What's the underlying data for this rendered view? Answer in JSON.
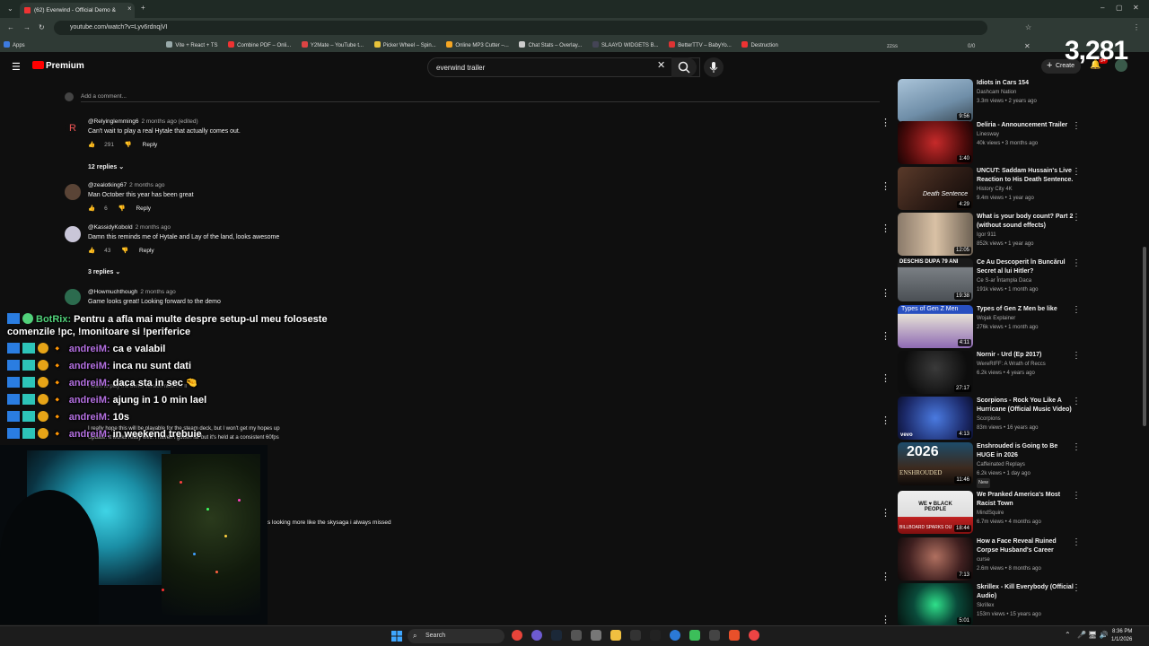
{
  "browser": {
    "tab_title": "(62) Everwind - Official Demo &",
    "url": "youtube.com/watch?v=Lyv6rdnqjVI",
    "bookmarks": [
      "Apps",
      "Vite + React + TS",
      "Combine PDF – Onli...",
      "Y2Mate – YouTube t...",
      "Picker Wheel – Spin...",
      "Online MP3 Cutter –...",
      "Chat Stats – Overlay...",
      "SLAAYD WIDGETS B...",
      "BetterTTV – BabyYo...",
      "Destruction"
    ],
    "find_text": "zzss",
    "find_count": "0/0"
  },
  "header": {
    "logo_text": "Premium",
    "search_value": "everwind trailer",
    "create_label": "Create",
    "notif_count": "9+",
    "viewer_count": "3,281"
  },
  "comments": {
    "add_placeholder": "Add a comment...",
    "items": [
      {
        "author": "@Relyinglemming6",
        "age": "2 months ago (edited)",
        "text": "Can't wait to play a real Hytale that actually comes out.",
        "likes": "291",
        "reply": "Reply",
        "replies": "12 replies"
      },
      {
        "author": "@zealotking67",
        "age": "2 months ago",
        "text": "Man October this year has been great",
        "likes": "6",
        "reply": "Reply",
        "replies": ""
      },
      {
        "author": "@KassidyKobold",
        "age": "2 months ago",
        "text": "Damn this reminds me of Hytale and Lay of the land, looks awesome",
        "likes": "43",
        "reply": "Reply",
        "replies": "3 replies"
      },
      {
        "author": "@Howmuchthough",
        "age": "2 months ago",
        "text": "Game looks great! Looking forward to the demo",
        "likes": "",
        "reply": "",
        "replies": ""
      }
    ],
    "partial_tail": "s looking more like the skysaga i always missed"
  },
  "chat": {
    "bot_name": "BotRix:",
    "bot_message_1": "Pentru a afla mai multe despre setup-ul meu foloseste",
    "bot_message_2": "comenzile !pc, !monitoare si !periferice",
    "lines": [
      {
        "name": "andreiM:",
        "text": "ca e valabil"
      },
      {
        "name": "andreiM:",
        "text": "inca nu sunt dati"
      },
      {
        "name": "andreiM:",
        "text": "daca sta in sec 🤏"
      },
      {
        "name": "andreiM:",
        "text": "ajung in 1 0 min lael"
      },
      {
        "name": "andreiM:",
        "text": "10s"
      },
      {
        "name": "andreiM:",
        "text": "in weekend trebuie"
      }
    ],
    "underlay": {
      "u1": "I want to play the demo version now!!!!!! ll",
      "u2": "I really hope this will be playable for the steam deck, but I won't get my hopes up",
      "u3": "Update: It works really well. I haven't gotten far but it's held at a consistent 60fps"
    }
  },
  "sidebar": {
    "videos": [
      {
        "title": "Idiots in Cars 154",
        "channel": "Dashcam Nation",
        "stats": "3.3m views • 2 years ago",
        "duration": "9:56",
        "new": ""
      },
      {
        "title": "Deliria - Announcement Trailer",
        "channel": "Linesway",
        "stats": "40k views • 3 months ago",
        "duration": "1:40",
        "new": ""
      },
      {
        "title": "UNCUT: Saddam Hussain's Live Reaction to His Death Sentence.",
        "channel": "History City 4K",
        "stats": "9.4m views • 1 year ago",
        "duration": "4:29",
        "new": ""
      },
      {
        "title": "What is your body count? Part 2 (without sound effects)",
        "channel": "Igor 911",
        "stats": "852k views • 1 year ago",
        "duration": "12:05",
        "new": ""
      },
      {
        "title": "Ce Au Descoperit în Buncărul Secret al lui Hitler?",
        "channel": "Ce S-ar Întampla Daca",
        "stats": "191k views • 1 month ago",
        "duration": "19:38",
        "new": ""
      },
      {
        "title": "Types of Gen Z Men be like",
        "channel": "Wojak Explainer",
        "stats": "276k views • 1 month ago",
        "duration": "4:11",
        "new": ""
      },
      {
        "title": "Nornir - Urd (Ep 2017)",
        "channel": "WereRIFF: A Wrath of Reccs",
        "stats": "6.2k views • 4 years ago",
        "duration": "27:17",
        "new": ""
      },
      {
        "title": "Scorpions - Rock You Like A Hurricane (Official Music Video)",
        "channel": "Scorpions",
        "stats": "83m views • 16 years ago",
        "duration": "4:13",
        "new": ""
      },
      {
        "title": "Enshrouded is Going to Be HUGE in 2026",
        "channel": "Caffeinated Replays",
        "stats": "6.2k views • 1 day ago",
        "duration": "11:46",
        "new": "New"
      },
      {
        "title": "We Pranked America's Most Racist Town",
        "channel": "MindSquire",
        "stats": "6.7m views • 4 months ago",
        "duration": "18:44",
        "new": ""
      },
      {
        "title": "How a Face Reveal Ruined Corpse Husband's Career",
        "channel": "curse",
        "stats": "2.6m views • 8 months ago",
        "duration": "7:13",
        "new": ""
      },
      {
        "title": "Skrillex - Kill Everybody (Official Audio)",
        "channel": "Skrillex",
        "stats": "153m views • 15 years ago",
        "duration": "5:01",
        "new": ""
      }
    ],
    "thumb_texts": {
      "t5": "DESCHIS DUPĂ 79 ANI",
      "t6": "Types of Gen Z Men",
      "t9": "2026",
      "t9b": "ENSHROUDED",
      "t10": "WE ♥ BLACK PEOPLE",
      "t10b": "BILLBOARD SPARKS OU",
      "t3": "Death Sentence",
      "t12": "vevo"
    }
  },
  "taskbar": {
    "search_label": "Search",
    "time": "8:36 PM",
    "date": "1/1/2026"
  },
  "colors": {
    "chat_name": "#b36fe0",
    "bot_name": "#51d17a",
    "yt_red": "#ff0000"
  }
}
